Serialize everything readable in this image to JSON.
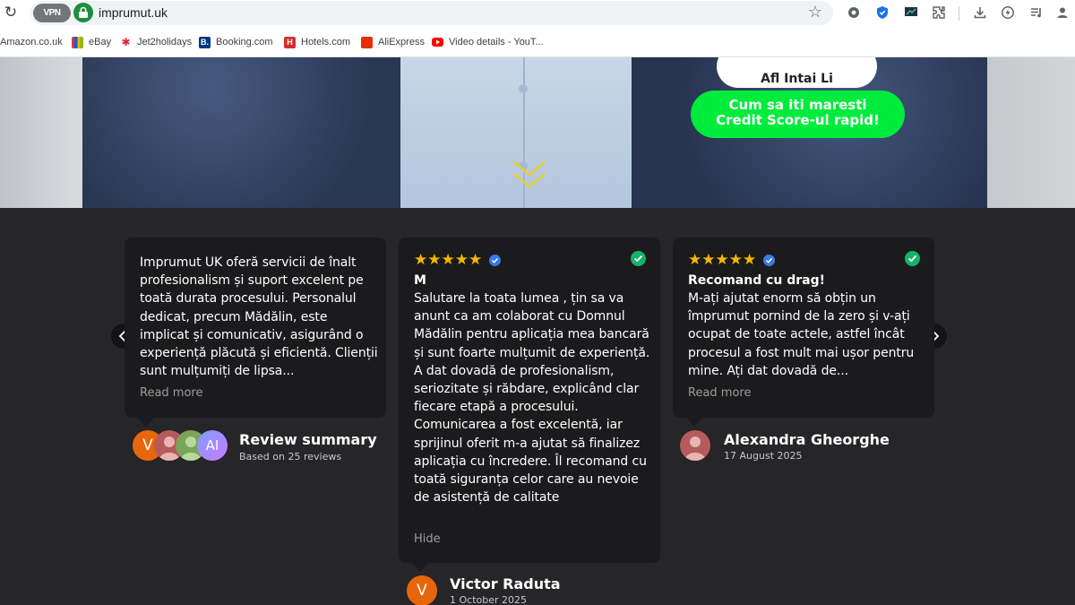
{
  "browser": {
    "vpn_label": "VPN",
    "url": "imprumut.uk",
    "bookmarks": [
      {
        "label": "Amazon.co.uk",
        "color": "#ff9900"
      },
      {
        "label": "eBay",
        "color": "#e53238"
      },
      {
        "label": "Jet2holidays",
        "color": "#e8242c"
      },
      {
        "label": "Booking.com",
        "color": "#003580"
      },
      {
        "label": "Hotels.com",
        "color": "#d32f2f"
      },
      {
        "label": "AliExpress",
        "color": "#e62e04"
      },
      {
        "label": "Video details - YouT...",
        "color": "#ff0000"
      }
    ]
  },
  "hero": {
    "white_button_label": "Afl Intai Li",
    "cta_label": "Cum sa iti maresti Credit Score-ul rapid!",
    "cta_color": "#00ec3d"
  },
  "reviews": {
    "summary": {
      "title": "Review summary",
      "subtitle": "Based on 25 reviews",
      "avatar_letter": "V",
      "ai_badge": "AI"
    },
    "items": [
      {
        "text": "Imprumut UK oferă servicii de înalt profesionalism și suport excelent pe toată durata procesului. Personalul dedicat, precum Mădălin, este implicat și comunicativ, asigurând o experiență plăcută și eficientă. Clienții sunt mulțumiți de lipsa...",
        "action": "Read more"
      },
      {
        "rating": "★★★★★",
        "title": "M",
        "text": "Salutare la toata lumea , țin sa va anunt ca am colaborat cu Domnul Mădălin pentru aplicația mea bancară și sunt foarte mulțumit de experiență. A dat dovadă de profesionalism, seriozitate și răbdare, explicând clar fiecare etapă a procesului. Comunicarea a fost excelentă, iar sprijinul oferit m-a ajutat să finalizez aplicația cu încredere. Îl recomand cu toată siguranța celor care au nevoie de asistență de calitate",
        "action": "Hide",
        "author": "Victor Raduta",
        "avatar_letter": "V",
        "date": "1 October 2025"
      },
      {
        "rating": "★★★★★",
        "title": "Recomand cu drag!",
        "text": "M-ați ajutat enorm să obțin un împrumut pornind de la zero și v-ați ocupat de toate actele, astfel încât procesul a fost mult mai ușor pentru mine. Ați dat dovadă de...",
        "action": "Read more",
        "author": "Alexandra Gheorghe",
        "date": "17 August 2025"
      }
    ],
    "prev_icon": "chevron-left-icon",
    "next_icon": "chevron-right-icon"
  }
}
